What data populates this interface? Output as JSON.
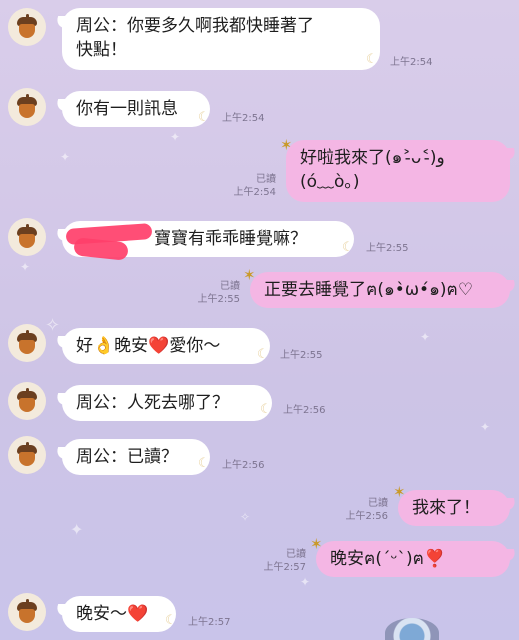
{
  "chat": {
    "messages": [
      {
        "side": "in",
        "lines": [
          "周公：你要多久啊我都快睡著了",
          "快點！"
        ],
        "time": "上午2:54"
      },
      {
        "side": "in",
        "lines": [
          "你有一則訊息"
        ],
        "time": "上午2:54"
      },
      {
        "side": "out",
        "lines": [
          "好啦我來了(๑˃̵ᴗ˂̵)و",
          "(ó﹏ò｡)"
        ],
        "read": "已讀",
        "time": "上午2:54"
      },
      {
        "side": "in",
        "lines": [
          "寶寶有乖乖睡覺嘛？"
        ],
        "time": "上午2:55"
      },
      {
        "side": "out",
        "lines": [
          "正要去睡覺了ฅ(๑•̀ω•́๑)ฅ♡"
        ],
        "read": "已讀",
        "time": "上午2:55"
      },
      {
        "side": "in",
        "lines": [
          "好👌晚安❤️愛你～"
        ],
        "time": "上午2:55"
      },
      {
        "side": "in",
        "lines": [
          "周公：人死去哪了？"
        ],
        "time": "上午2:56"
      },
      {
        "side": "in",
        "lines": [
          "周公：已讀？"
        ],
        "time": "上午2:56"
      },
      {
        "side": "out",
        "lines": [
          "我來了！"
        ],
        "read": "已讀",
        "time": "上午2:56"
      },
      {
        "side": "out",
        "lines": [
          "晚安ฅ(ˊᵕˋ)ฅ❣️"
        ],
        "read": "已讀",
        "time": "上午2:57"
      },
      {
        "side": "in",
        "lines": [
          "晚安～❤️"
        ],
        "time": "上午2:57"
      }
    ]
  },
  "icons": {
    "avatar": "acorn-icon",
    "read_marker": "moon-icon",
    "sent_marker": "star-icon"
  },
  "colors": {
    "incoming_bubble": "#ffffff",
    "outgoing_bubble": "#f4b6e4",
    "redaction": "#ff3f6a"
  }
}
